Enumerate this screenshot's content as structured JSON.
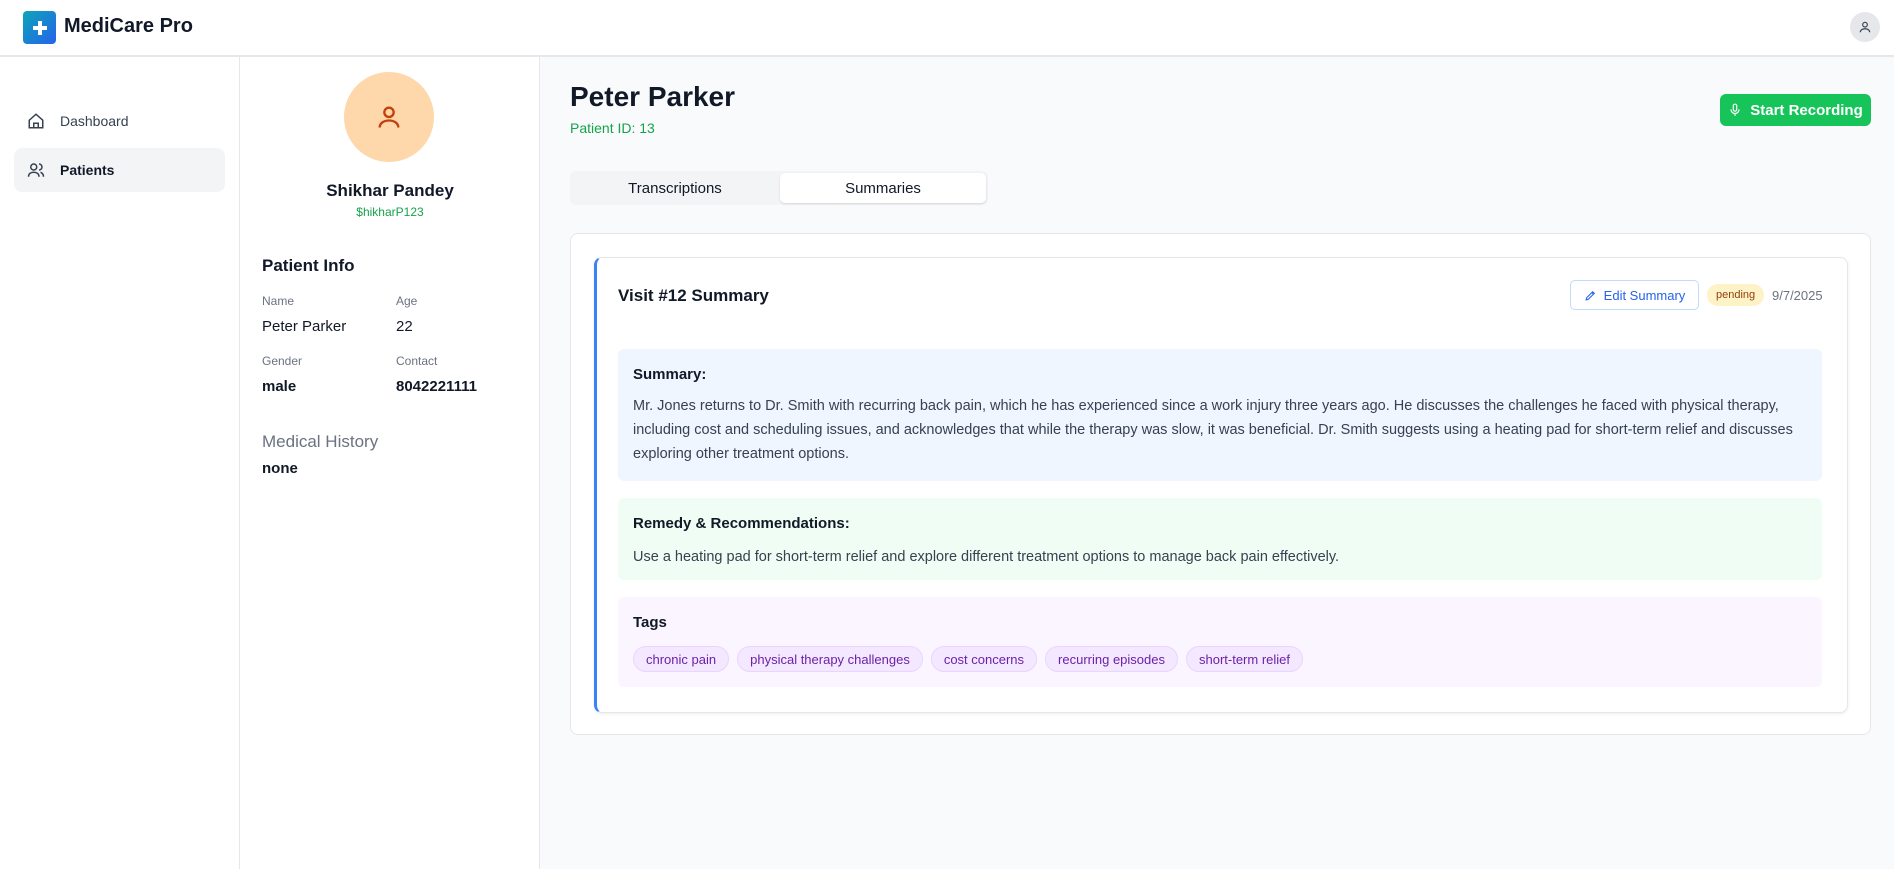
{
  "app": {
    "brand": "MediCare Pro",
    "accent_color": "#16c45a"
  },
  "nav": {
    "items": [
      {
        "label": "Dashboard",
        "icon": "home-icon",
        "active": false
      },
      {
        "label": "Patients",
        "icon": "users-icon",
        "active": true
      }
    ]
  },
  "doctor": {
    "name": "Shikhar Pandey",
    "handle": "$hikharP123"
  },
  "patient_info": {
    "title": "Patient Info",
    "name_label": "Name",
    "name": "Peter Parker",
    "age_label": "Age",
    "age": "22",
    "gender_label": "Gender",
    "gender": "male",
    "contact_label": "Contact",
    "contact": "8042221111",
    "medical_history_label": "Medical History",
    "medical_history": "none"
  },
  "header": {
    "patient_name": "Peter Parker",
    "patient_id": "Patient ID: 13",
    "record_button": "Start Recording"
  },
  "tabs": [
    {
      "label": "Transcriptions",
      "active": false
    },
    {
      "label": "Summaries",
      "active": true
    }
  ],
  "visit": {
    "title": "Visit #12 Summary",
    "edit_label": "Edit Summary",
    "status": "pending",
    "date": "9/7/2025",
    "summary_title": "Summary:",
    "summary_text": "Mr. Jones returns to Dr. Smith with recurring back pain, which he has experienced since a work injury three years ago. He discusses the challenges he faced with physical therapy, including cost and scheduling issues, and acknowledges that while the therapy was slow, it was beneficial. Dr. Smith suggests using a heating pad for short-term relief and discusses exploring other treatment options.",
    "remedy_title": "Remedy & Recommendations:",
    "remedy_text": "Use a heating pad for short-term relief and explore different treatment options to manage back pain effectively.",
    "tags_title": "Tags",
    "tags": [
      "chronic pain",
      "physical therapy challenges",
      "cost concerns",
      "recurring episodes",
      "short-term relief"
    ]
  }
}
